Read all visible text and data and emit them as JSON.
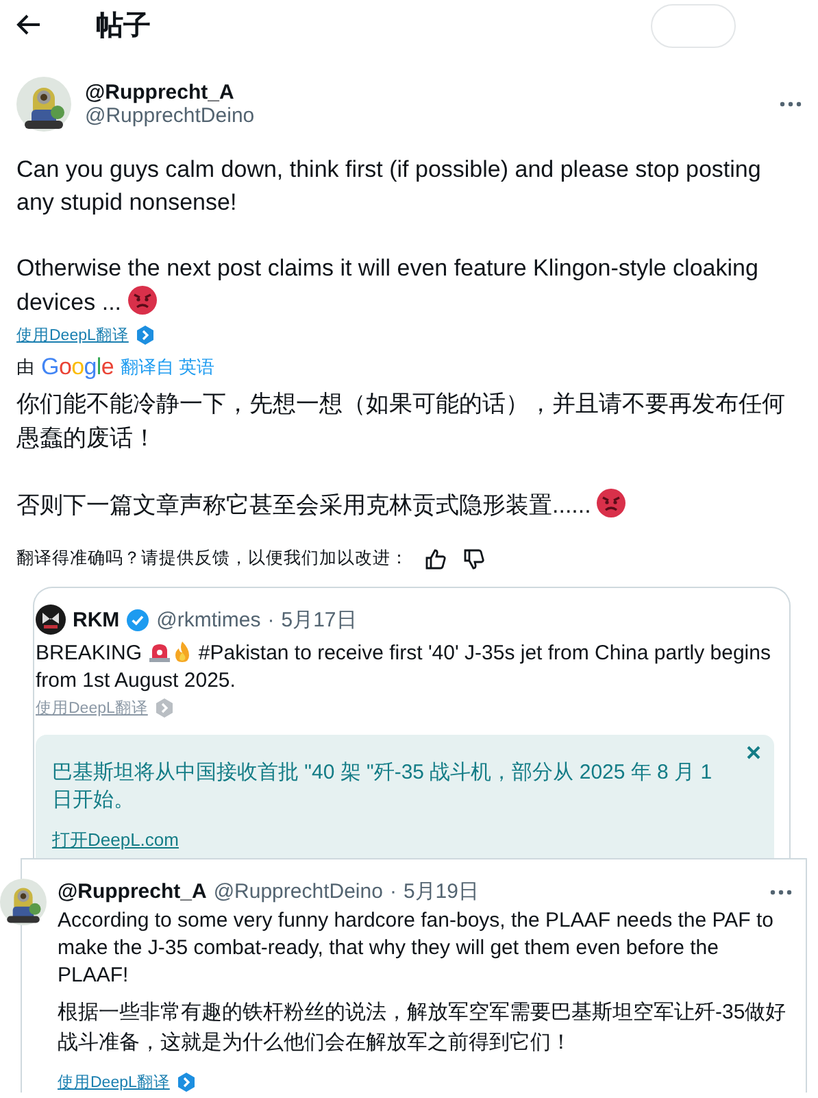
{
  "header": {
    "title": "帖子"
  },
  "post": {
    "display_name": "@Rupprecht_A",
    "handle": "@RupprechtDeino",
    "paragraphs": [
      "Can you guys calm down, think first (if possible) and please stop posting any stupid nonsense!",
      "Otherwise the next post claims it will even feature Klingon-style cloaking devices ..."
    ],
    "deepl_link": "使用DeepL翻译",
    "translation": {
      "by": "由",
      "brand": "Google",
      "from": "翻译自 英语",
      "paragraphs": [
        "你们能不能冷静一下，先想一想（如果可能的话），并且请不要再发布任何愚蠢的废话！",
        "否则下一篇文章声称它甚至会采用克林贡式隐形装置......"
      ],
      "feedback": "翻译得准确吗？请提供反馈，以便我们加以改进："
    }
  },
  "quote": {
    "name": "RKM",
    "verified": true,
    "handle": "@rkmtimes",
    "separator": "·",
    "date": "5月17日",
    "lead": "BREAKING",
    "text": "#Pakistan to receive first '40' J-35s jet from China partly begins from 1st August 2025.",
    "deepl_link": "使用DeepL翻译",
    "deepl_panel": {
      "text": "巴基斯坦将从中国接收首批 \"40 架 \"歼-35 战斗机，部分从 2025 年 8 月 1 日开始。",
      "link": "打开DeepL.com"
    }
  },
  "reply": {
    "display_name": "@Rupprecht_A",
    "handle": "@RupprechtDeino",
    "separator": "·",
    "date": "5月19日",
    "text": "According to some very funny hardcore fan-boys, the PLAAF needs the PAF to make the J-35 combat-ready, that why they will get them even before the PLAAF!",
    "translation": "根据一些非常有趣的铁杆粉丝的说法，解放军空军需要巴基斯坦空军让歼-35做好战斗准备，这就是为什么他们会在解放军之前得到它们！",
    "deepl_link": "使用DeepL翻译"
  }
}
